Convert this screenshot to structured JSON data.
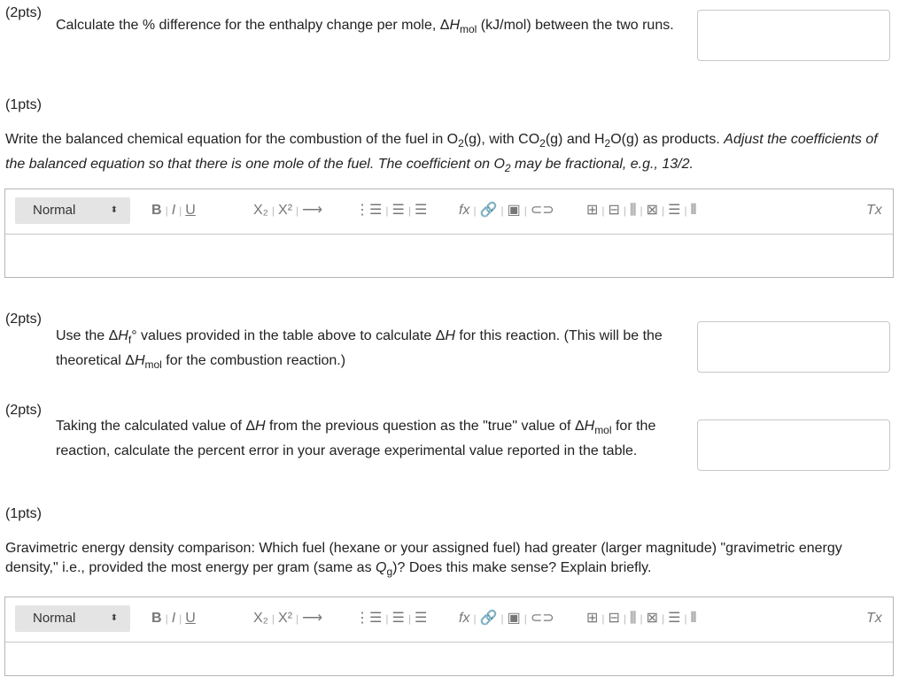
{
  "q1": {
    "points": "(2pts)",
    "text_a": "Calculate the % difference for the enthalpy change per mole, Δ",
    "text_h": "H",
    "text_sub": "mol",
    "text_b": " (kJ/mol) between the two runs."
  },
  "q2": {
    "points": "(1pts)",
    "text_a": "Write the balanced chemical equation for the combustion of the fuel in O",
    "sub1": "2",
    "text_b": "(g), with CO",
    "sub2": "2",
    "text_c": "(g) and H",
    "sub3": "2",
    "text_d": "O(g) as products. ",
    "italic_a": "Adjust the coefficients of the balanced equation so that there is one mole of the fuel. The coefficient on O",
    "italic_sub": "2",
    "italic_b": " may be fractional, e.g., 13/2."
  },
  "editor": {
    "format_label": "Normal",
    "format_caret": "⬍",
    "bold": "B",
    "italic": "I",
    "underline": "U",
    "subscript": "X₂",
    "superscript": "X²",
    "arrow": "⟶",
    "ordered_list": "⋮☰",
    "bullet_list": "☰",
    "align": "☰",
    "formula": "fx",
    "link": "🔗",
    "image": "▣",
    "attach": "⊂⊃",
    "table": "⊞",
    "clear_format": "Tx"
  },
  "q3": {
    "points": "(2pts)",
    "text_a": "Use the Δ",
    "text_h": "H",
    "text_sub": "f",
    "text_deg": "°",
    "text_b": " values provided in the table above to calculate Δ",
    "text_h2": "H",
    "text_c": " for this reaction. (This will be the theoretical Δ",
    "text_h3": "H",
    "text_sub2": "mol",
    "text_d": " for the combustion reaction.)"
  },
  "q4": {
    "points": "(2pts)",
    "text_a": "Taking the calculated value of Δ",
    "text_h": "H",
    "text_b": " from the previous question as the \"true\" value of Δ",
    "text_h2": "H",
    "text_sub": "mol",
    "text_c": " for the reaction, calculate the percent error in your average experimental value reported in the table."
  },
  "q5": {
    "points": "(1pts)",
    "text_a": "Gravimetric energy density comparison: Which fuel (hexane or your assigned fuel) had greater (larger magnitude) \"gravimetric energy density,\" i.e., provided the most energy per gram (same as ",
    "text_q": "Q",
    "text_sub": "g",
    "text_b": ")? Does this make sense? Explain briefly."
  }
}
